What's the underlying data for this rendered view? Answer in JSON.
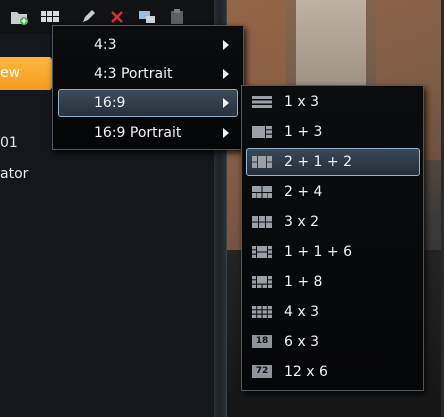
{
  "left_panel": {
    "new_tab_label": "ew",
    "line_1": "01",
    "line_2": "ator"
  },
  "aspect_menu": {
    "items": [
      {
        "label": "4:3",
        "has_submenu": true
      },
      {
        "label": "4:3 Portrait",
        "has_submenu": true
      },
      {
        "label": "16:9",
        "has_submenu": true,
        "selected": true
      },
      {
        "label": "16:9 Portrait",
        "has_submenu": true
      }
    ]
  },
  "layout_menu": {
    "items": [
      {
        "label": "1 x 3",
        "icon": "layout-1x3-icon"
      },
      {
        "label": "1 + 3",
        "icon": "layout-1-plus-3-icon"
      },
      {
        "label": "2 + 1 + 2",
        "icon": "layout-2-1-2-icon",
        "selected": true
      },
      {
        "label": "2 + 4",
        "icon": "layout-2-plus-4-icon"
      },
      {
        "label": "3 x 2",
        "icon": "layout-3x2-icon"
      },
      {
        "label": "1 + 1 + 6",
        "icon": "layout-1-1-6-icon"
      },
      {
        "label": "1 + 8",
        "icon": "layout-1-plus-8-icon"
      },
      {
        "label": "4 x 3",
        "icon": "layout-4x3-icon"
      },
      {
        "label": "6 x 3",
        "icon": "layout-6x3-icon",
        "badge": "18"
      },
      {
        "label": "12 x 6",
        "icon": "layout-12x6-icon",
        "badge": "72"
      }
    ]
  },
  "colors": {
    "accent_orange": "#f7a325",
    "selection_border": "#8fb0c8",
    "menu_bg": "#07090b"
  }
}
